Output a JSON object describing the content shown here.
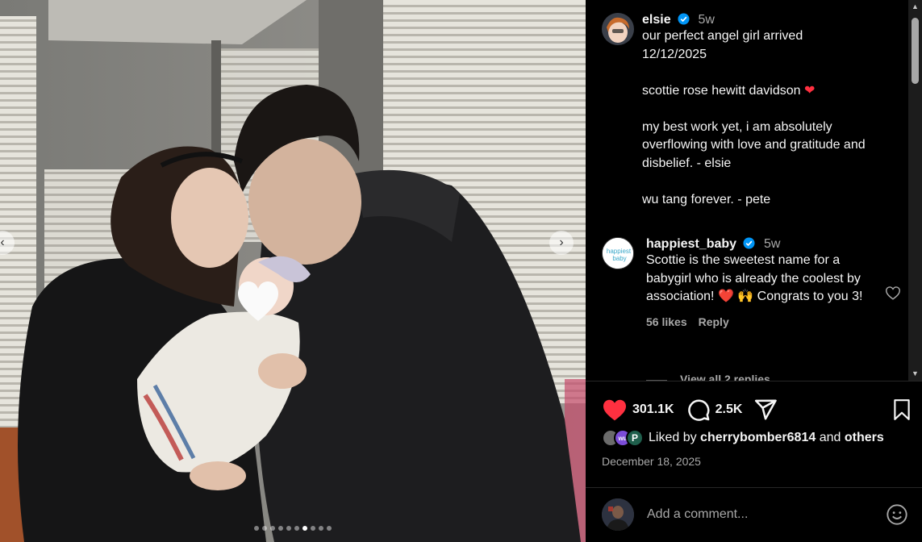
{
  "post": {
    "username": "elsie",
    "time": "5w",
    "caption": [
      "our perfect angel girl arrived",
      "12/12/2025",
      "",
      "scottie rose hewitt davidson",
      "",
      "my best work yet, i am absolutely overflowing with love and gratitude and disbelief. - elsie",
      "",
      "wu tang forever. - pete"
    ],
    "caption_emoji": "❤"
  },
  "comment": {
    "username": "happiest_baby",
    "time": "5w",
    "avatar_text": "happiest baby",
    "text": "Scottie is the sweetest name for a babygirl who is already the coolest by association! ❤️ 🙌 Congrats to you 3!",
    "likes": "56 likes",
    "reply_label": "Reply",
    "view_replies": "View all 2 replies"
  },
  "actions": {
    "like_count": "301.1K",
    "comment_count": "2.5K"
  },
  "liked_by": {
    "prefix": "Liked by",
    "user": "cherrybomber6814",
    "and": "and",
    "others": "others",
    "mini_avatars": [
      "",
      "wu",
      "P"
    ]
  },
  "date": "December 18, 2025",
  "comment_input": {
    "placeholder": "Add a comment..."
  },
  "colors": {
    "like_red": "#ff3040",
    "verified_blue": "#0095f6",
    "secondary_text": "#a8a8a8"
  },
  "carousel": {
    "slide_count": 10,
    "active_index": 6
  }
}
